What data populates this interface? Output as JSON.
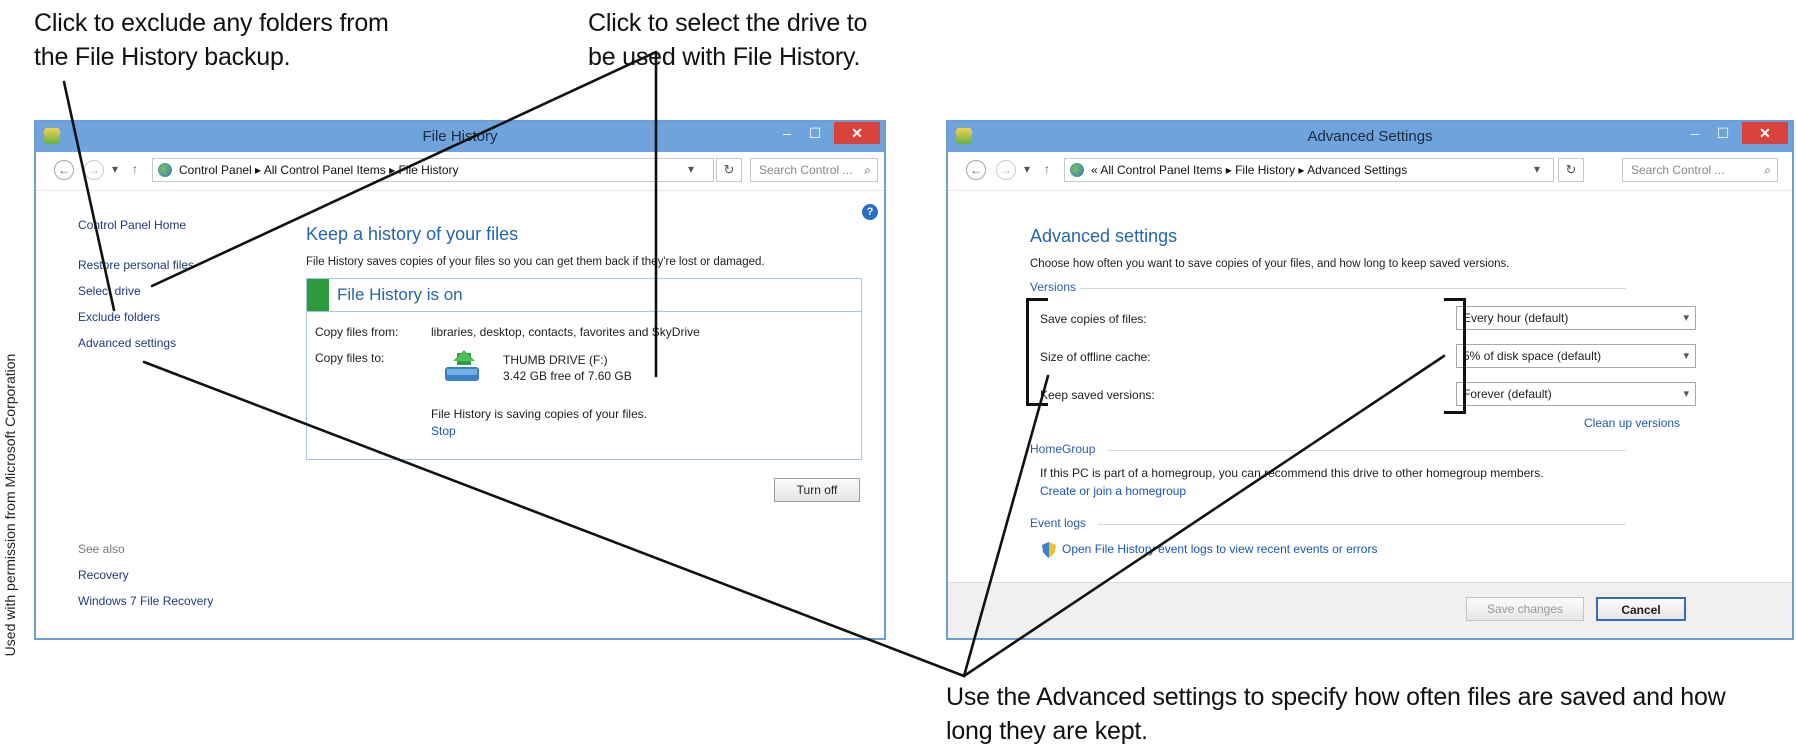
{
  "callouts": {
    "exclude_l1": "Click to exclude any folders from",
    "exclude_l2": "the File History backup.",
    "select_l1": "Click to select the drive to",
    "select_l2": "be used with File History.",
    "advanced_l1": "Use the Advanced settings to specify how often files are saved and how",
    "advanced_l2": "long they are kept."
  },
  "credit": "Used with permission from Microsoft Corporation",
  "file_history": {
    "title": "File History",
    "breadcrumb": "Control Panel  ▸  All Control Panel Items  ▸  File History",
    "search_placeholder": "Search Control ...",
    "sidebar": {
      "home": "Control Panel Home",
      "items": [
        "Restore personal files",
        "Select drive",
        "Exclude folders",
        "Advanced settings"
      ],
      "see_also": "See also",
      "see_also_items": [
        "Recovery",
        "Windows 7 File Recovery"
      ]
    },
    "heading": "Keep a history of your files",
    "description": "File History saves copies of your files so you can get them back if they're lost or damaged.",
    "status": "File History is on",
    "copy_from_label": "Copy files from:",
    "copy_from_value": "libraries, desktop, contacts, favorites and SkyDrive",
    "copy_to_label": "Copy files to:",
    "drive_name": "THUMB DRIVE (F:)",
    "drive_space": "3.42 GB free of 7.60 GB",
    "saving_msg": "File History is saving copies of your files.",
    "stop": "Stop",
    "turn_off": "Turn off",
    "help": "?"
  },
  "advanced": {
    "title": "Advanced Settings",
    "breadcrumb": "«  All Control Panel Items  ▸  File History  ▸  Advanced Settings",
    "search_placeholder": "Search Control ...",
    "heading": "Advanced settings",
    "description": "Choose how often you want to save copies of your files, and how long to keep saved versions.",
    "versions_group": "Versions",
    "save_copies_label": "Save copies of files:",
    "save_copies_value": "Every hour (default)",
    "offline_cache_label": "Size of offline cache:",
    "offline_cache_value": "5% of disk space (default)",
    "keep_versions_label": "Keep saved versions:",
    "keep_versions_value": "Forever (default)",
    "clean_up": "Clean up versions",
    "homegroup_group": "HomeGroup",
    "homegroup_text": "If this PC is part of a homegroup, you can recommend this drive to other homegroup members.",
    "homegroup_link": "Create or join a homegroup",
    "eventlogs_group": "Event logs",
    "eventlogs_link": "Open File History event logs to view recent events or errors",
    "save_changes": "Save changes",
    "cancel": "Cancel"
  },
  "window_controls": {
    "minimize": "–",
    "maximize": "☐",
    "close": "✕"
  },
  "colors": {
    "titlebar": "#6fa3dc",
    "close": "#d9433a",
    "link": "#1a55b5",
    "heading": "#2564b0",
    "status_green": "#2d9a3c"
  }
}
